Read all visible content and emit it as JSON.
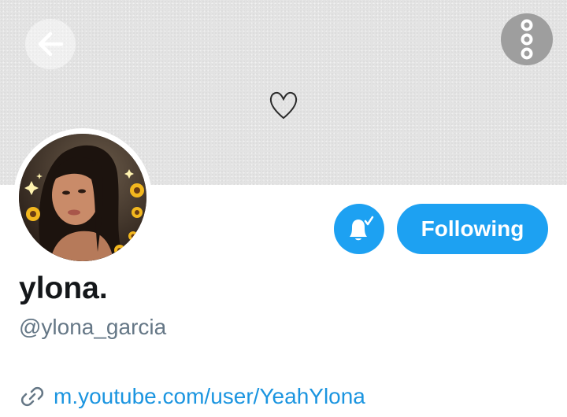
{
  "header": {
    "back_icon": "arrow-left-icon",
    "more_icon": "vertical-dots-icon",
    "banner_icon": "heart-outline-icon"
  },
  "profile": {
    "display_name": "ylona.",
    "handle": "@ylona_garcia",
    "website": "m.youtube.com/user/YeahYlona",
    "website_icon": "link-icon"
  },
  "actions": {
    "notify_icon": "bell-check-icon",
    "follow_label": "Following"
  },
  "colors": {
    "accent": "#1da1f2",
    "link": "#1b95e0",
    "handle": "#657786",
    "name": "#14171a",
    "banner": "#e3e3e3"
  }
}
